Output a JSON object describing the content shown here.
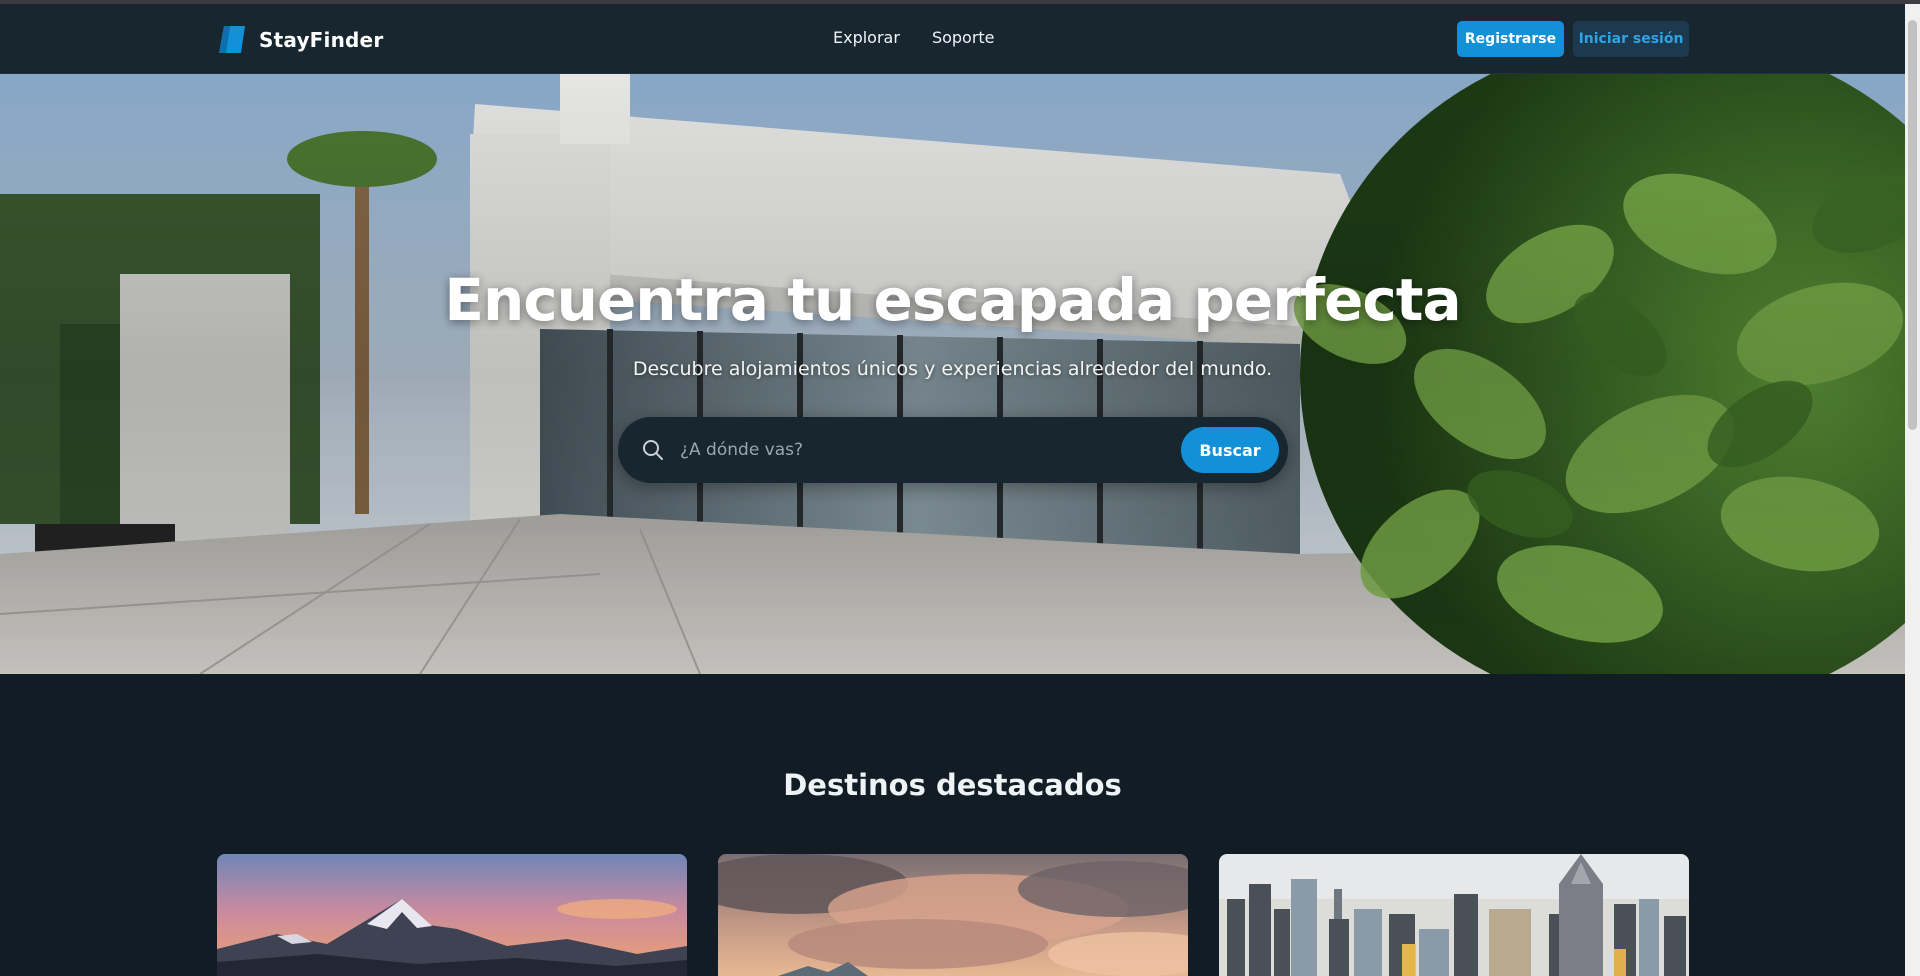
{
  "brand": {
    "name": "StayFinder"
  },
  "nav": {
    "links": [
      "Explorar",
      "Soporte"
    ]
  },
  "auth": {
    "register_label": "Registrarse",
    "login_label": "Iniciar sesión"
  },
  "hero": {
    "title": "Encuentra tu escapada perfecta",
    "subtitle": "Descubre alojamientos únicos y experiencias alrededor del mundo.",
    "search": {
      "placeholder": "¿A dónde vas?",
      "button_label": "Buscar"
    }
  },
  "featured": {
    "title": "Destinos destacados",
    "cards": [
      {
        "image": "mountain-sunset-image"
      },
      {
        "image": "cloudy-sky-image"
      },
      {
        "image": "city-skyline-image"
      }
    ]
  },
  "colors": {
    "accent": "#1290d8",
    "navbar_bg": "#182630",
    "page_bg": "#111c24",
    "login_bg": "#1b3a4f",
    "login_text": "#2fa3e4"
  }
}
